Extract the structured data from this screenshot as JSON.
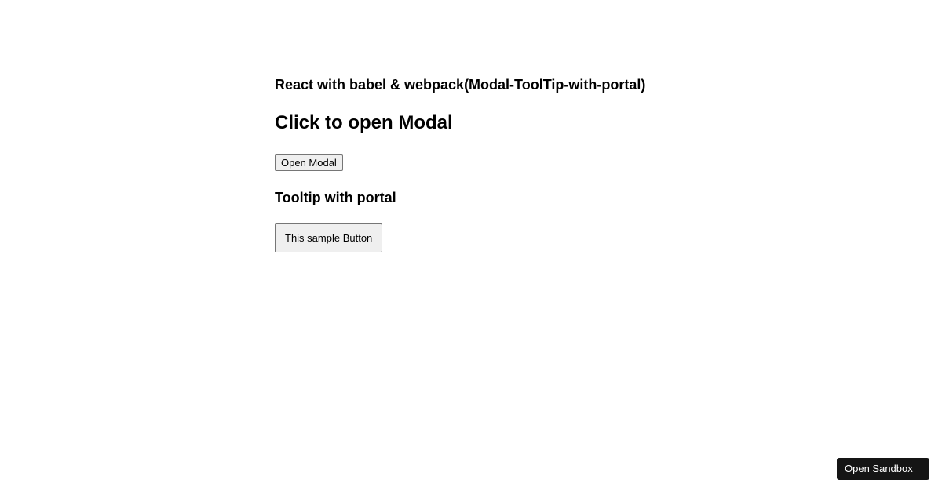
{
  "headings": {
    "title": "React with babel & webpack(Modal-ToolTip-with-portal)",
    "modal_section": "Click to open Modal",
    "tooltip_section": "Tooltip with portal"
  },
  "buttons": {
    "open_modal": "Open Modal",
    "sample": "This sample Button",
    "open_sandbox": "Open Sandbox"
  }
}
